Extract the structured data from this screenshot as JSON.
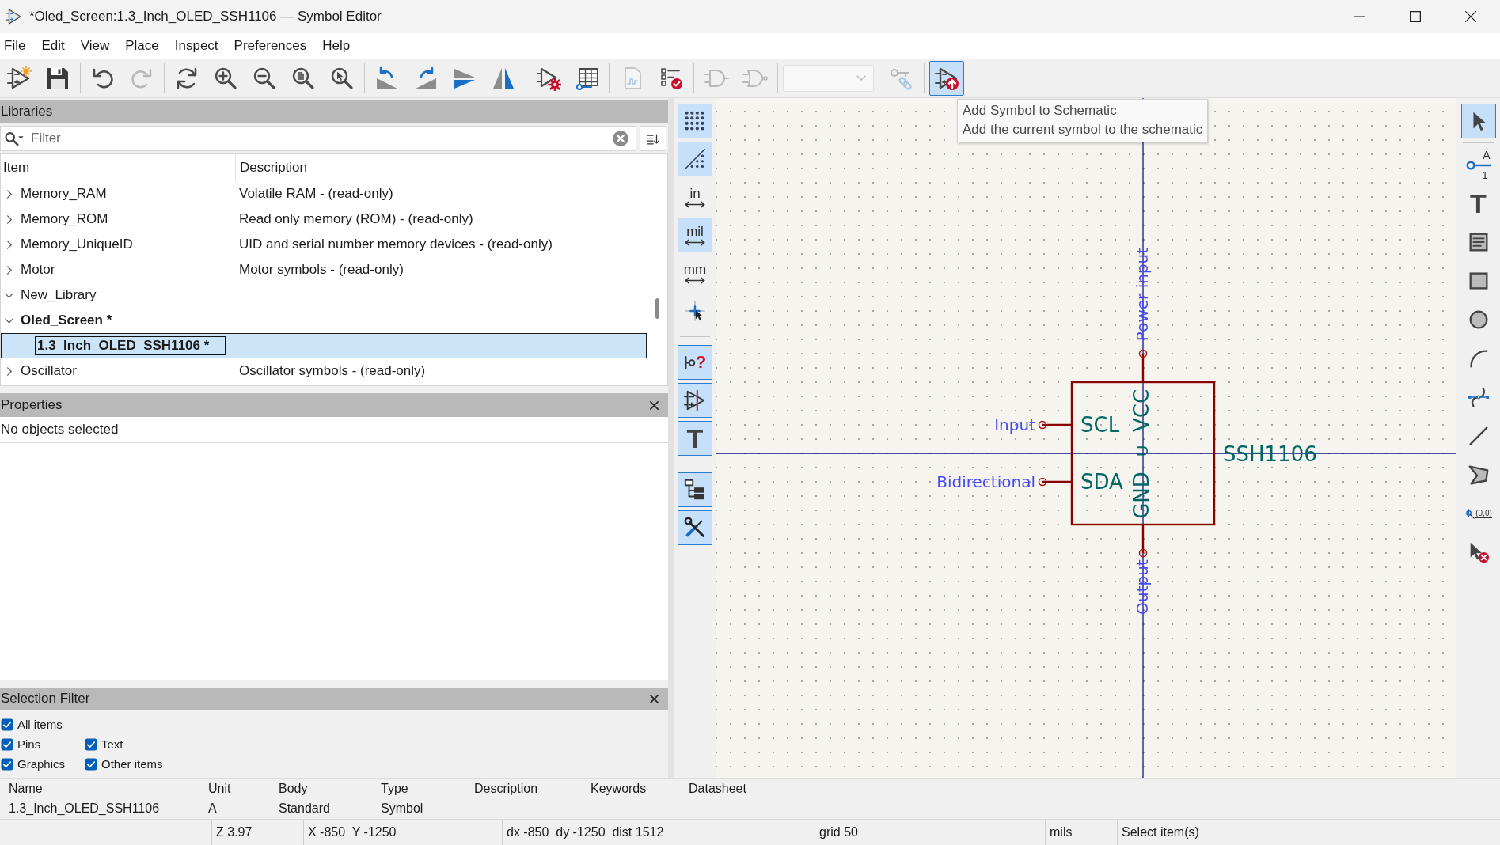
{
  "window": {
    "title": "*Oled_Screen:1.3_Inch_OLED_SSH1106 — Symbol Editor"
  },
  "menu": [
    "File",
    "Edit",
    "View",
    "Place",
    "Inspect",
    "Preferences",
    "Help"
  ],
  "toolbar": [
    {
      "kind": "button",
      "disabled": false,
      "hovered": false
    },
    {
      "kind": "button",
      "disabled": false,
      "hovered": false
    },
    {
      "kind": "separator"
    },
    {
      "kind": "button",
      "disabled": false,
      "hovered": false
    },
    {
      "kind": "button",
      "disabled": true,
      "hovered": false
    },
    {
      "kind": "separator"
    },
    {
      "kind": "button",
      "disabled": false,
      "hovered": false
    },
    {
      "kind": "button",
      "disabled": false,
      "hovered": false
    },
    {
      "kind": "button",
      "disabled": false,
      "hovered": false
    },
    {
      "kind": "button",
      "disabled": false,
      "hovered": false
    },
    {
      "kind": "button",
      "disabled": false,
      "hovered": false
    },
    {
      "kind": "separator"
    },
    {
      "kind": "button",
      "disabled": false,
      "hovered": false
    },
    {
      "kind": "button",
      "disabled": false,
      "hovered": false
    },
    {
      "kind": "button",
      "disabled": false,
      "hovered": false
    },
    {
      "kind": "button",
      "disabled": false,
      "hovered": false
    },
    {
      "kind": "separator"
    },
    {
      "kind": "button",
      "disabled": false,
      "hovered": false
    },
    {
      "kind": "button",
      "disabled": false,
      "hovered": false
    },
    {
      "kind": "separator"
    },
    {
      "kind": "button",
      "disabled": true,
      "hovered": false
    },
    {
      "kind": "button",
      "disabled": false,
      "hovered": false
    },
    {
      "kind": "separator"
    },
    {
      "kind": "button",
      "disabled": true,
      "hovered": false
    },
    {
      "kind": "button",
      "disabled": true,
      "hovered": false
    },
    {
      "kind": "separator"
    },
    {
      "kind": "dropdown",
      "disabled": true
    },
    {
      "kind": "separator"
    },
    {
      "kind": "button",
      "disabled": true,
      "hovered": false
    },
    {
      "kind": "separator"
    },
    {
      "kind": "button",
      "disabled": false,
      "hovered": true
    }
  ],
  "tooltip": {
    "title": "Add Symbol to Schematic",
    "text": "Add the current symbol to the schematic"
  },
  "libraries": {
    "title": "Libraries",
    "filter": {
      "placeholder": "Filter"
    },
    "columns": [
      "Item",
      "Description"
    ],
    "rows": [
      {
        "item": "Memory_RAM",
        "description": "Volatile RAM - (read-only)",
        "expanded": false,
        "current": false,
        "selected": false
      },
      {
        "item": "Memory_ROM",
        "description": "Read only memory (ROM) - (read-only)",
        "expanded": false,
        "current": false,
        "selected": false
      },
      {
        "item": "Memory_UniqueID",
        "description": "UID and serial number memory devices - (read-only)",
        "expanded": false,
        "current": false,
        "selected": false
      },
      {
        "item": "Motor",
        "description": "Motor symbols - (read-only)",
        "expanded": false,
        "current": false,
        "selected": false
      },
      {
        "item": "New_Library",
        "expanded": true,
        "current": false,
        "selected": false
      },
      {
        "item": "Oled_Screen *",
        "expanded": true,
        "current": true,
        "selected": false,
        "children": [
          {
            "item": "1.3_Inch_OLED_SSH1106 *",
            "current": true,
            "selected": true
          }
        ]
      },
      {
        "item": "Oscillator",
        "description": "Oscillator symbols - (read-only)",
        "expanded": false,
        "current": false,
        "selected": false
      }
    ]
  },
  "properties": {
    "title": "Properties",
    "message": "No objects selected"
  },
  "selection_filter": {
    "title": "Selection Filter",
    "options": [
      {
        "label": "All items",
        "checked": true
      },
      {
        "label": "Pins",
        "checked": true
      },
      {
        "label": "Text",
        "checked": true
      },
      {
        "label": "Graphics",
        "checked": true
      },
      {
        "label": "Other items",
        "checked": true
      }
    ]
  },
  "view_toolbar": [
    {
      "kind": "button",
      "on": true
    },
    {
      "kind": "button",
      "on": true
    },
    {
      "kind": "unit",
      "label": "in",
      "on": false
    },
    {
      "kind": "unit",
      "label": "mil",
      "on": true
    },
    {
      "kind": "unit",
      "label": "mm",
      "on": false
    },
    {
      "kind": "button",
      "on": false
    },
    {
      "kind": "separator"
    },
    {
      "kind": "query",
      "label": "?",
      "on": true
    },
    {
      "kind": "button",
      "on": true
    },
    {
      "kind": "text",
      "label": "T",
      "on": true
    },
    {
      "kind": "separator"
    },
    {
      "kind": "button",
      "on": true
    },
    {
      "kind": "button",
      "on": true
    }
  ],
  "canvas": {
    "symbol": {
      "value": "SSH1106",
      "reference": "U",
      "pins": [
        {
          "name": "SCL",
          "electrical_type": "Input",
          "kind": "left"
        },
        {
          "name": "SDA",
          "electrical_type": "Bidirectional",
          "kind": "left"
        },
        {
          "name": "VCC",
          "electrical_type": "Power input",
          "kind": "top"
        },
        {
          "name": "GND",
          "electrical_type": "Output",
          "kind": "bottom"
        }
      ]
    }
  },
  "tools": [
    {
      "kind": "button",
      "selected": true
    },
    {
      "kind": "separator"
    },
    {
      "kind": "pin",
      "label": "A",
      "sublabel": "1",
      "selected": false
    },
    {
      "kind": "text",
      "label": "T",
      "selected": false
    },
    {
      "kind": "button",
      "selected": false
    },
    {
      "kind": "button",
      "selected": false
    },
    {
      "kind": "button",
      "selected": false
    },
    {
      "kind": "button",
      "selected": false
    },
    {
      "kind": "button",
      "selected": false
    },
    {
      "kind": "button",
      "selected": false
    },
    {
      "kind": "button",
      "selected": false
    },
    {
      "kind": "anchor",
      "label": "(0,0)",
      "selected": false
    },
    {
      "kind": "button",
      "selected": false
    }
  ],
  "symbol_info": {
    "columns": [
      "Name",
      "Unit",
      "Body",
      "Type",
      "Description",
      "Keywords",
      "Datasheet"
    ],
    "values": [
      "1.3_Inch_OLED_SSH1106",
      "A",
      "Standard",
      "Symbol"
    ]
  },
  "status_bar": [
    "Z 3.97",
    "X -850  Y -1250",
    "dx -850  dy -1250  dist 1512",
    "grid 50",
    "mils",
    "Select item(s)"
  ]
}
